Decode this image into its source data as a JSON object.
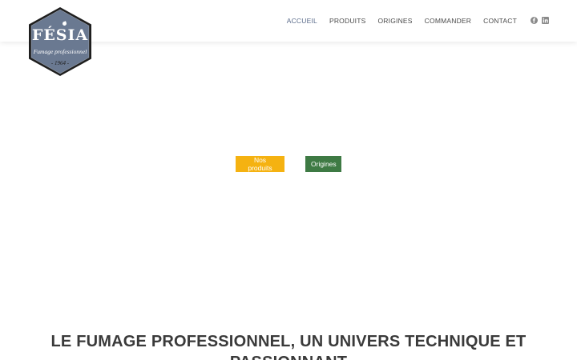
{
  "logo": {
    "name": "FÉSIA",
    "tagline": "Fumage professionnel",
    "year": "- 1964 -",
    "color": "#6a7991",
    "border_color": "#1e1e1e"
  },
  "nav": {
    "items": [
      {
        "label": "ACCUEIL",
        "active": true
      },
      {
        "label": "PRODUITS",
        "active": false
      },
      {
        "label": "ORIGINES",
        "active": false
      },
      {
        "label": "COMMANDER",
        "active": false
      },
      {
        "label": "CONTACT",
        "active": false
      }
    ],
    "active_color": "#5a6b8a"
  },
  "social": {
    "icons": [
      "facebook-icon",
      "linkedin-icon"
    ],
    "color": "#8a8a8a"
  },
  "hero": {
    "buttons": {
      "products_label": "Nos produits",
      "origins_label": "Origines"
    },
    "colors": {
      "products": "#f5b211",
      "origins": "#3e7a44"
    }
  },
  "section": {
    "title": "LE FUMAGE PROFESSIONNEL, UN UNIVERS TECHNIQUE ET PASSIONNANT"
  }
}
